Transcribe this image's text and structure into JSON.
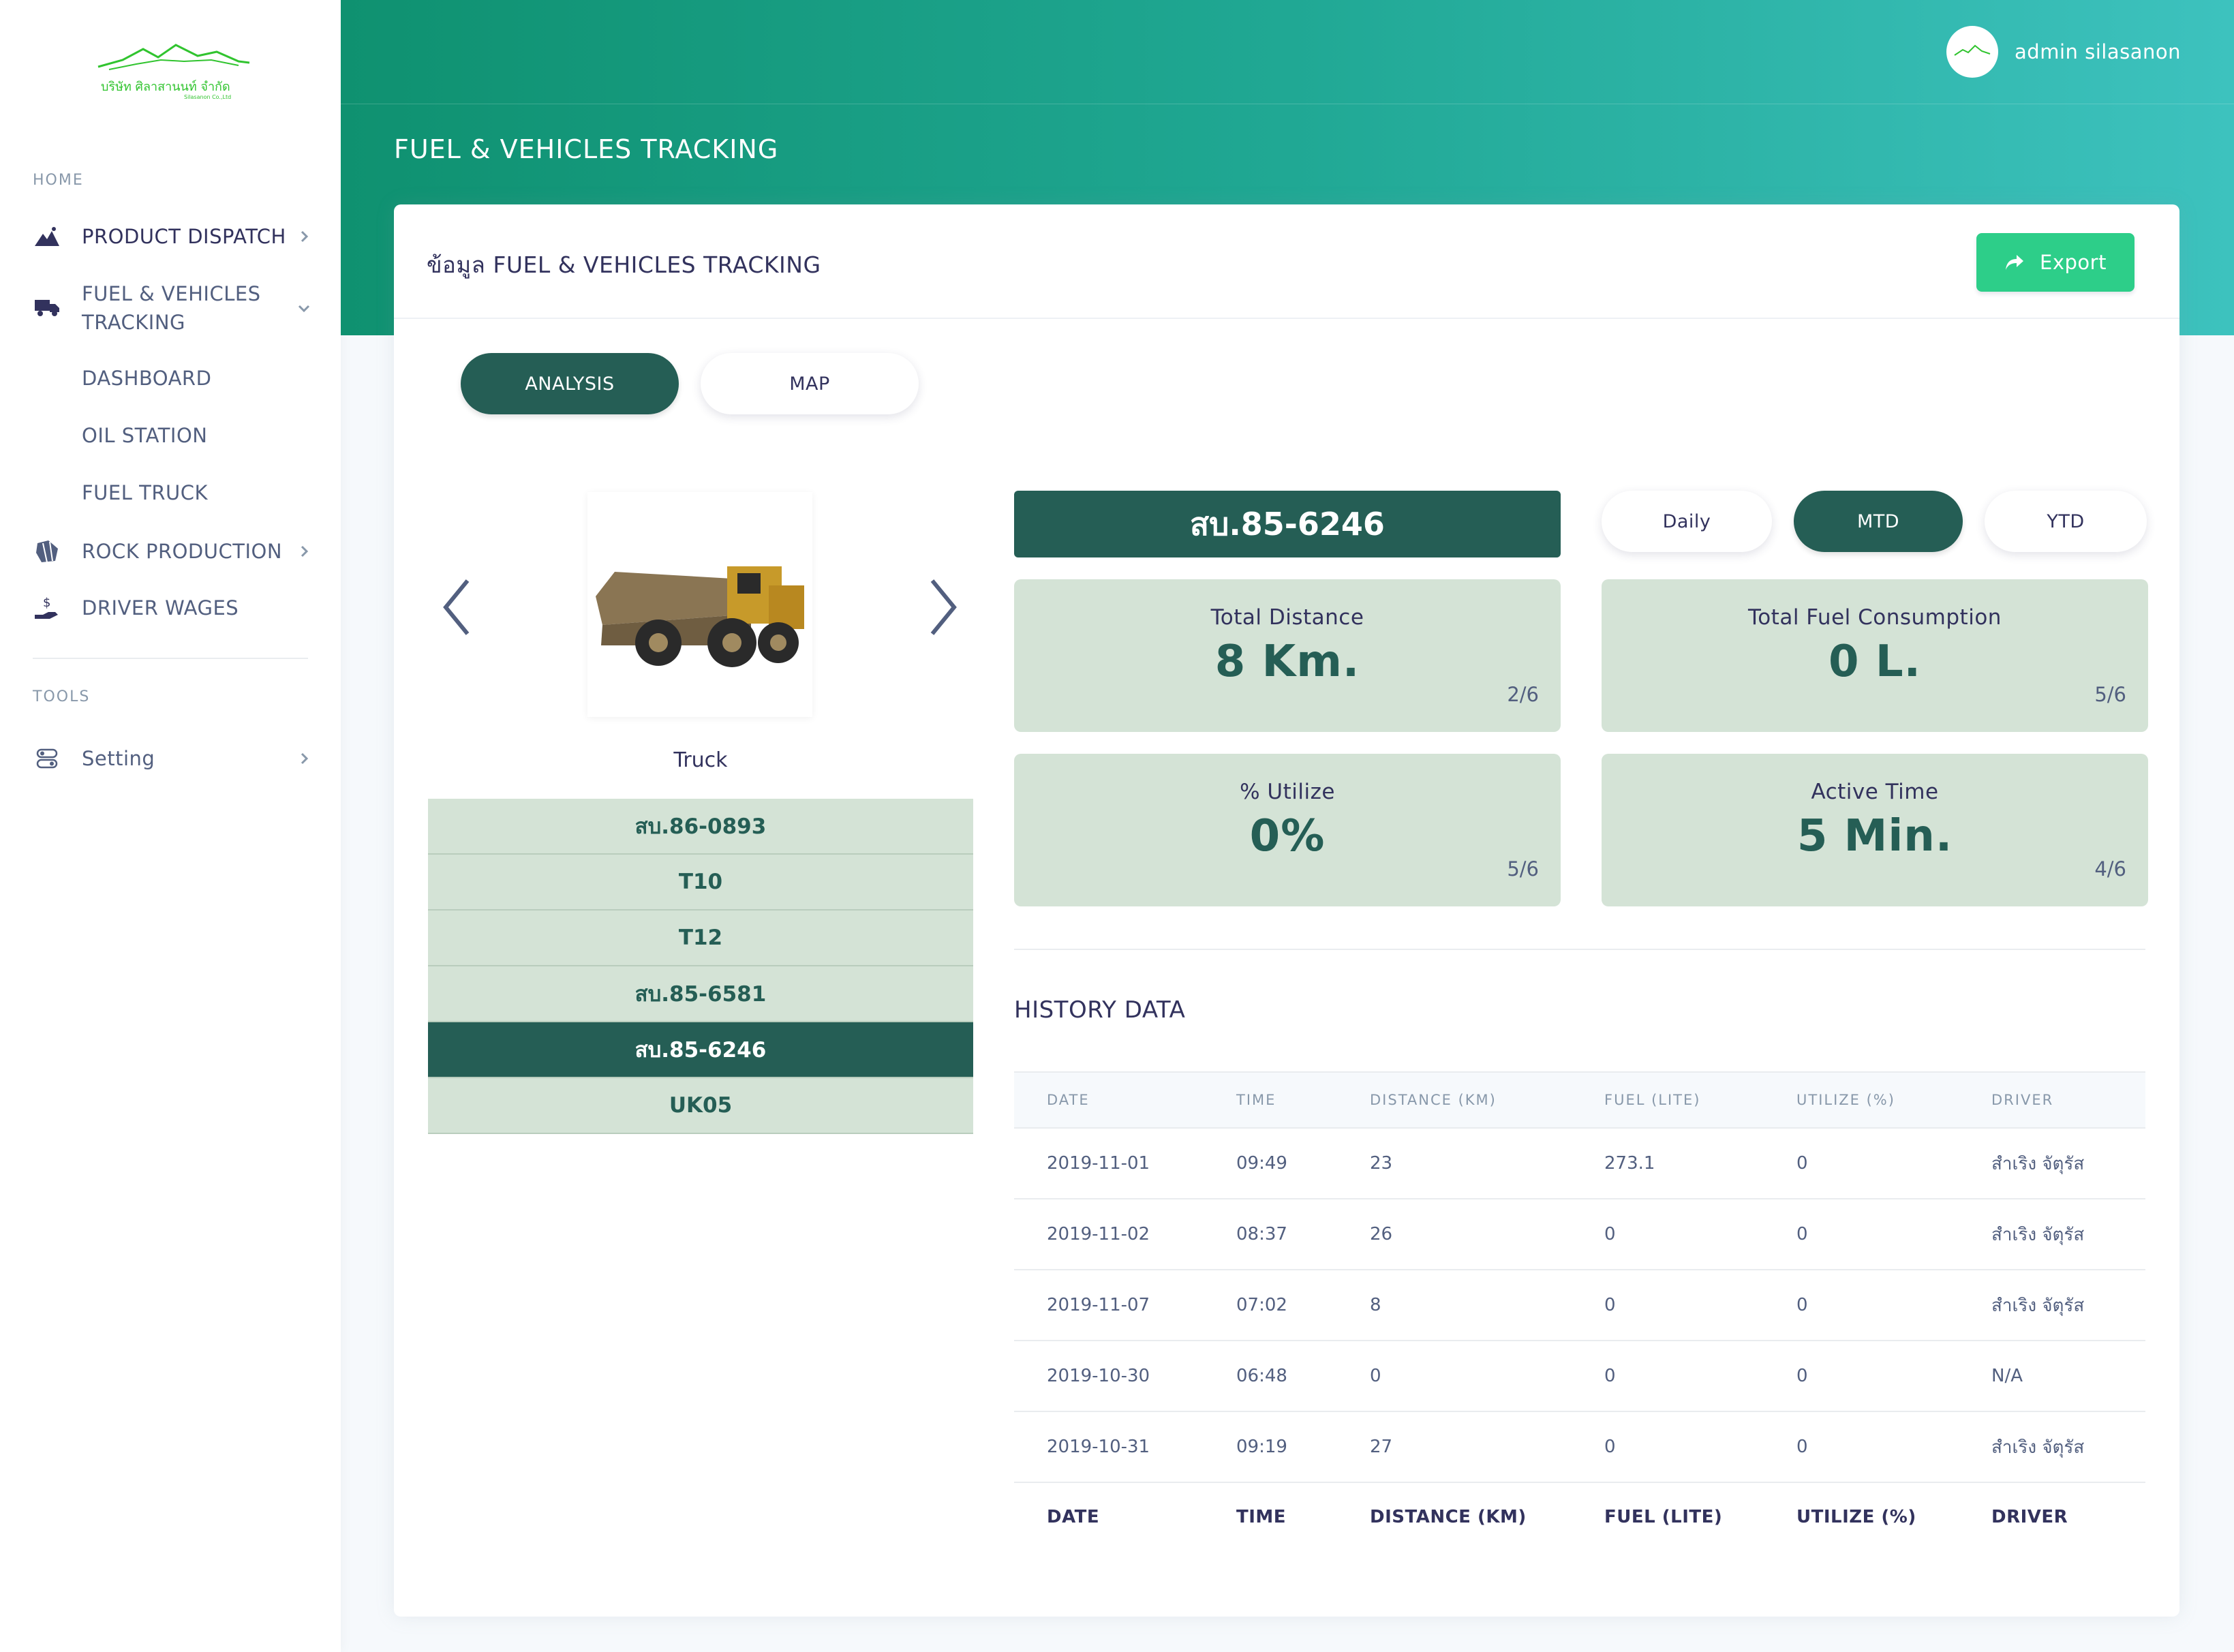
{
  "logo": {
    "brand_text": "บริษัท ศิลาสานนท์ จำกัด",
    "brand_sub": "Silasanon Co.,Ltd"
  },
  "sidebar": {
    "home_heading": "HOME",
    "items": [
      {
        "label": "PRODUCT DISPATCH",
        "icon": "mountain-icon"
      },
      {
        "label": "FUEL & VEHICLES TRACKING",
        "icon": "truck-icon",
        "expanded": true
      },
      {
        "label": "ROCK PRODUCTION",
        "icon": "rock-icon"
      },
      {
        "label": "DRIVER WAGES",
        "icon": "hand-money-icon"
      }
    ],
    "fuel_subitems": [
      {
        "label": "DASHBOARD"
      },
      {
        "label": "OIL STATION"
      },
      {
        "label": "FUEL TRUCK"
      }
    ],
    "tools_heading": "TOOLS",
    "tools_items": [
      {
        "label": "Setting",
        "icon": "settings-icon"
      }
    ]
  },
  "header": {
    "user_name": "admin silasanon",
    "page_title": "FUEL & VEHICLES TRACKING"
  },
  "card": {
    "title": "ข้อมูล FUEL & VEHICLES TRACKING",
    "export_label": "Export"
  },
  "view_tabs": [
    {
      "label": "ANALYSIS",
      "active": true
    },
    {
      "label": "MAP",
      "active": false
    }
  ],
  "vehicle": {
    "type_label": "Truck",
    "list": [
      "สบ.86-0893",
      "T10",
      "T12",
      "สบ.85-6581",
      "สบ.85-6246",
      "UK05"
    ],
    "selected": "สบ.85-6246"
  },
  "period_tabs": [
    {
      "label": "Daily",
      "active": false
    },
    {
      "label": "MTD",
      "active": true
    },
    {
      "label": "YTD",
      "active": false
    }
  ],
  "stats": {
    "total_distance": {
      "label": "Total Distance",
      "value": "8 Km.",
      "ratio": "2/6"
    },
    "total_fuel": {
      "label": "Total Fuel Consumption",
      "value": "0 L.",
      "ratio": "5/6"
    },
    "utilize": {
      "label": "% Utilize",
      "value": "0%",
      "ratio": "5/6"
    },
    "active_time": {
      "label": "Active Time",
      "value": "5 Min.",
      "ratio": "4/6"
    }
  },
  "history": {
    "title": "HISTORY DATA",
    "columns": [
      "DATE",
      "TIME",
      "DISTANCE (KM)",
      "FUEL (LITE)",
      "UTILIZE (%)",
      "DRIVER"
    ],
    "rows": [
      [
        "2019-11-01",
        "09:49",
        "23",
        "273.1",
        "0",
        "สำเริง จัตุรัส"
      ],
      [
        "2019-11-02",
        "08:37",
        "26",
        "0",
        "0",
        "สำเริง จัตุรัส"
      ],
      [
        "2019-11-07",
        "07:02",
        "8",
        "0",
        "0",
        "สำเริง จัตุรัส"
      ],
      [
        "2019-10-30",
        "06:48",
        "0",
        "0",
        "0",
        "N/A"
      ],
      [
        "2019-10-31",
        "09:19",
        "27",
        "0",
        "0",
        "สำเริง จัตุรัส"
      ]
    ]
  },
  "colors": {
    "primary": "#255e55",
    "accent_green": "#2dce89",
    "stat_bg": "#d4e3d6",
    "header_start": "#0f9170",
    "header_end": "#3dc2be"
  }
}
